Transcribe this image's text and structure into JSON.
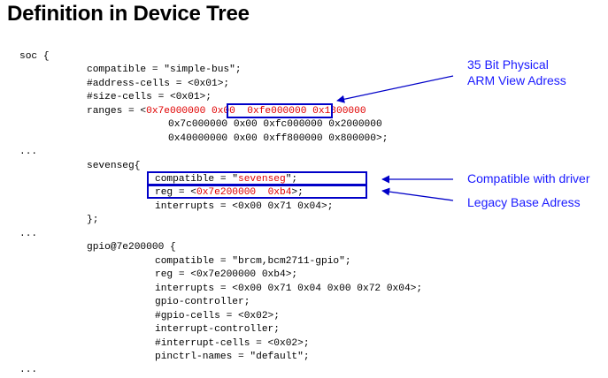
{
  "title": "Definition in Device Tree",
  "code": {
    "soc_open": "soc {",
    "soc_compatible": "compatible = \"simple-bus\";",
    "soc_address_cells": "#address-cells = <0x01>;",
    "soc_size_cells": "#size-cells = <0x01>;",
    "ranges_prefix": "ranges = <",
    "ranges_a": "0x7e000000",
    "ranges_b": " 0x00  0xfe000000",
    "ranges_c": " 0x1800000",
    "ranges_line2": "0x7c000000 0x00 0xfc000000 0x2000000",
    "ranges_line3": "0x40000000 0x00 0xff800000 0x800000>;",
    "ellipsis_1": "...",
    "sevenseg_open": "sevenseg{",
    "sevenseg_compatible_prefix": "compatible = \"",
    "sevenseg_compatible_value": "sevenseg",
    "sevenseg_compatible_suffix": "\";",
    "sevenseg_reg_prefix": "reg = <",
    "sevenseg_reg_value": "0x7e200000  0xb4",
    "sevenseg_reg_suffix": ">;",
    "sevenseg_interrupts": "interrupts = <0x00 0x71 0x04>;",
    "sevenseg_close": "};",
    "ellipsis_2": "...",
    "gpio_open": "gpio@7e200000 {",
    "gpio_compatible": "compatible = \"brcm,bcm2711-gpio\";",
    "gpio_reg": "reg = <0x7e200000 0xb4>;",
    "gpio_interrupts": "interrupts = <0x00 0x71 0x04 0x00 0x72 0x04>;",
    "gpio_controller": "gpio-controller;",
    "gpio_cells": "#gpio-cells = <0x02>;",
    "interrupt_controller": "interrupt-controller;",
    "interrupt_cells": "#interrupt-cells = <0x02>;",
    "pinctrl_names": "pinctrl-names = \"default\";",
    "ellipsis_3": "..."
  },
  "annotations": {
    "physical_line1": "35 Bit Physical",
    "physical_line2": "ARM View Adress",
    "compatible": "Compatible with driver",
    "legacy": "Legacy Base Adress"
  },
  "colors": {
    "highlight_red": "#e00000",
    "box_blue": "#0000c8",
    "annotation_blue": "#1a1aff"
  }
}
